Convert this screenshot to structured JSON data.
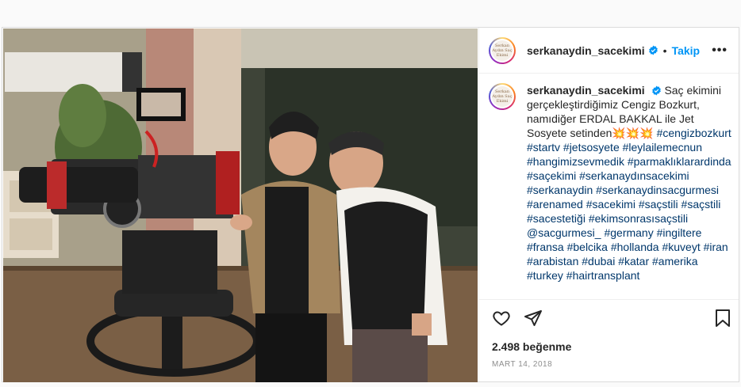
{
  "post": {
    "username": "serkanaydin_sacekimi",
    "follow_label": "Takip",
    "separator": "•",
    "more_label": "•••",
    "avatar_text": "Serkan Aydın Saç Ekimi",
    "caption_text": "Saç ekimini gerçekleştirdiğimiz Cengiz Bozkurt, namıdiğer ERDAL BAKKAL ile Jet Sosyete setinden💥💥💥",
    "hashtags": "#cengizbozkurt #startv #jetsosyete #leylailemecnun #hangimizsevmedik #parmaklıklarardinda #saçekimi #serkanaydınsacekimi #serkanaydin #serkanaydinsacgurmesi #arenamed #sacekimi #saçstili #saçstili #sacestetiği #ekimsonrasısaçstili @sacgurmesi_ #germany #ingiltere #fransa #belcika #hollanda #kuveyt #iran #arabistan #dubai #katar #amerika #turkey #hairtransplant",
    "likes": "2.498 beğenme",
    "date": "MART 14, 2018"
  },
  "icons": {
    "verified": "verified-badge-icon",
    "like": "heart-icon",
    "share": "paper-plane-icon",
    "save": "bookmark-icon"
  },
  "colors": {
    "accent": "#0095f6",
    "verified": "#0095f6",
    "hashtag": "#00376b",
    "text": "#262626",
    "muted": "#8e8e8e"
  }
}
